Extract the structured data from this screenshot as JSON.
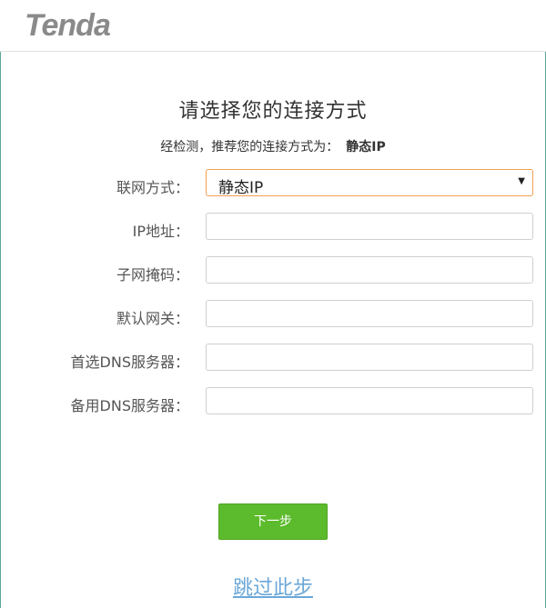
{
  "brand": {
    "logo_text": "Tenda",
    "logo_color": "#8a8a8a"
  },
  "page": {
    "title": "请选择您的连接方式",
    "detect_prefix": "经检测，推荐您的连接方式为：",
    "detect_value": "静态IP"
  },
  "form": {
    "connection_type": {
      "label": "联网方式：",
      "value": "静态IP"
    },
    "ip_address": {
      "label": "IP地址：",
      "value": ""
    },
    "subnet_mask": {
      "label": "子网掩码：",
      "value": ""
    },
    "gateway": {
      "label": "默认网关：",
      "value": ""
    },
    "primary_dns": {
      "label": "首选DNS服务器：",
      "value": ""
    },
    "secondary_dns": {
      "label": "备用DNS服务器：",
      "value": ""
    }
  },
  "actions": {
    "next_label": "下一步",
    "skip_label": "跳过此步"
  },
  "colors": {
    "accent_green": "#5cbb2c",
    "link_blue": "#6aa7d8",
    "select_focus": "#f0a050"
  }
}
